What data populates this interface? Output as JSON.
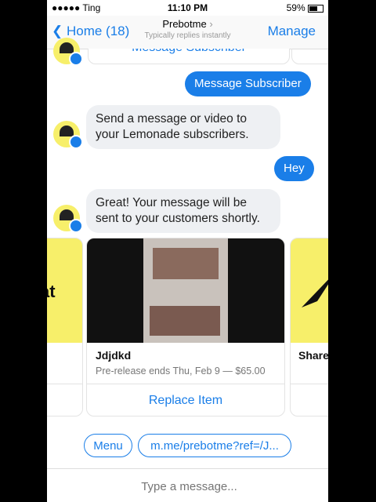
{
  "status": {
    "carrier": "●●●●● Ting",
    "time": "11:10 PM",
    "battery": "59%"
  },
  "header": {
    "back": "Home (18)",
    "title": "Prebotme",
    "subtitle": "Typically replies instantly",
    "manage": "Manage"
  },
  "messages": {
    "partial_button": "Message Subscriber",
    "out1": "Message Subscriber",
    "in1": "Send a message or video to your Lemonade subscribers.",
    "out2": "Hey",
    "in2": "Great! Your message will be sent to your customers shortly."
  },
  "carousel": {
    "left_text": "at",
    "main": {
      "name": "Jdjdkd",
      "desc": "Pre-release ends Thu, Feb 9 — $65.00",
      "button": "Replace Item"
    },
    "right_name": "Share"
  },
  "quick_replies": [
    "Menu",
    "m.me/prebotme?ref=/J..."
  ],
  "composer": {
    "placeholder": "Type a message..."
  }
}
